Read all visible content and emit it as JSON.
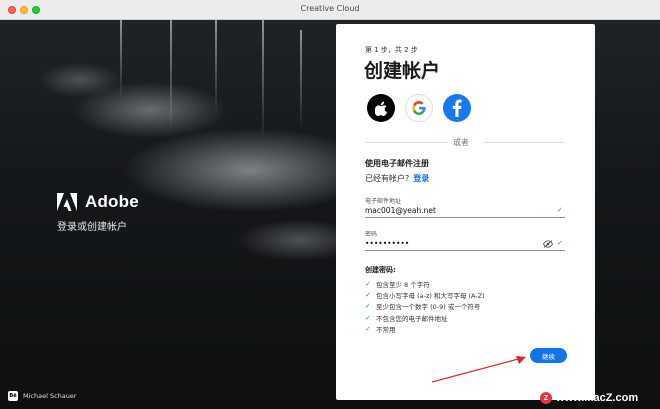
{
  "window": {
    "title": "Creative Cloud"
  },
  "brand": {
    "name": "Adobe",
    "subtitle": "登录或创建帐户",
    "photo_credit": "Michael Schauer",
    "credit_badge": "Bē"
  },
  "card": {
    "step": "第 1 步，共 2 步",
    "heading": "创建帐户",
    "social": [
      "apple-icon",
      "google-icon",
      "facebook-icon"
    ],
    "or": "或者",
    "email_title": "使用电子邮件注册",
    "have_account": "已经有帐户?",
    "login": "登录",
    "email_label": "电子邮件地址",
    "email_value": "mac001@yeah.net",
    "password_label": "密码",
    "password_value": "••••••••••",
    "requirements_title": "创建密码:",
    "requirements": [
      "包含至少 8 个字符",
      "包含小写字母 (a-z) 和大写字母 (A-Z)",
      "至少包含一个数字 (0-9) 或一个符号",
      "不包含您的电子邮件地址",
      "不常用"
    ],
    "continue": "继续"
  },
  "watermark": {
    "badge": "Z",
    "text": "www.MacZ.com"
  },
  "colors": {
    "accent": "#1473e6",
    "check": "#2d9d78",
    "facebook": "#1877f2",
    "annotation": "#d9262c"
  }
}
